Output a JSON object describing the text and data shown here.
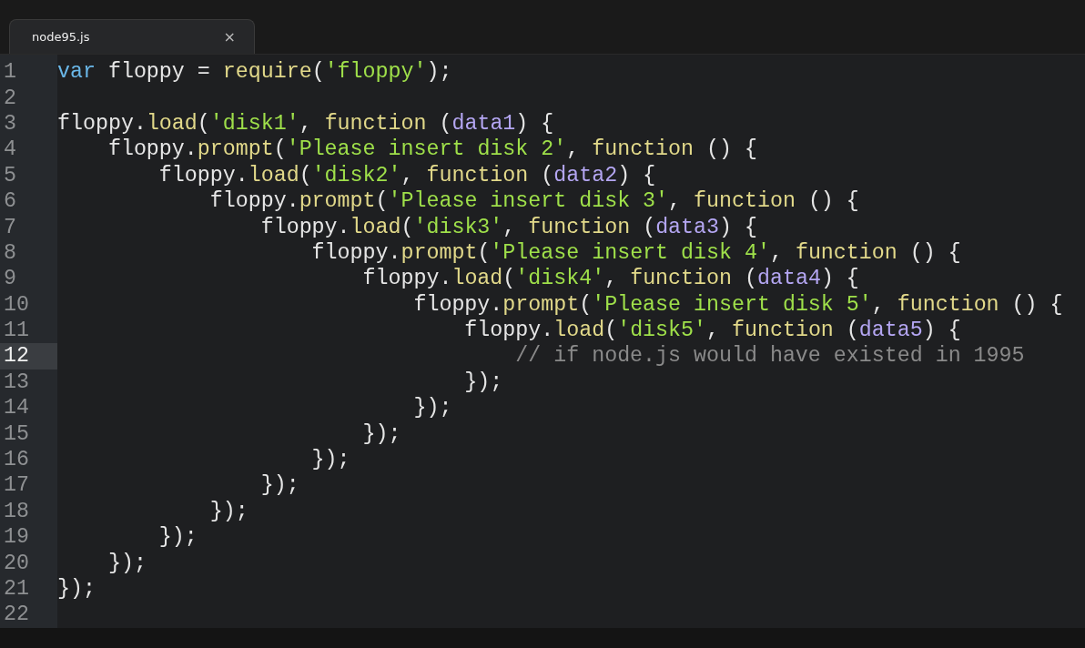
{
  "tabs": [
    {
      "title": "node95.js",
      "close": "×",
      "selected": true
    }
  ],
  "lines": [
    {
      "number": "1",
      "selected": false,
      "tokens": [
        {
          "kind": "keyword",
          "text": "var"
        },
        {
          "kind": "plain",
          "text": " floppy = "
        },
        {
          "kind": "call",
          "text": "require"
        },
        {
          "kind": "plain",
          "text": "("
        },
        {
          "kind": "string",
          "text": "'floppy'"
        },
        {
          "kind": "plain",
          "text": ");"
        }
      ]
    },
    {
      "number": "2",
      "selected": false
    },
    {
      "number": "3",
      "selected": false,
      "tokens": [
        {
          "kind": "plain",
          "text": "floppy."
        },
        {
          "kind": "call",
          "text": "load"
        },
        {
          "kind": "plain",
          "text": "("
        },
        {
          "kind": "string",
          "text": "'disk1'"
        },
        {
          "kind": "plain",
          "text": ", "
        },
        {
          "kind": "call",
          "text": "function"
        },
        {
          "kind": "plain",
          "text": " ("
        },
        {
          "kind": "param",
          "text": "data1"
        },
        {
          "kind": "plain",
          "text": ") {"
        }
      ]
    },
    {
      "number": "4",
      "selected": false,
      "tokens": [
        {
          "kind": "plain",
          "text": "    floppy."
        },
        {
          "kind": "call",
          "text": "prompt"
        },
        {
          "kind": "plain",
          "text": "("
        },
        {
          "kind": "string",
          "text": "'Please insert disk 2'"
        },
        {
          "kind": "plain",
          "text": ", "
        },
        {
          "kind": "call",
          "text": "function"
        },
        {
          "kind": "plain",
          "text": " () {"
        }
      ]
    },
    {
      "number": "5",
      "selected": false,
      "tokens": [
        {
          "kind": "plain",
          "text": "        floppy."
        },
        {
          "kind": "call",
          "text": "load"
        },
        {
          "kind": "plain",
          "text": "("
        },
        {
          "kind": "string",
          "text": "'disk2'"
        },
        {
          "kind": "plain",
          "text": ", "
        },
        {
          "kind": "call",
          "text": "function"
        },
        {
          "kind": "plain",
          "text": " ("
        },
        {
          "kind": "param",
          "text": "data2"
        },
        {
          "kind": "plain",
          "text": ") {"
        }
      ]
    },
    {
      "number": "6",
      "selected": false,
      "tokens": [
        {
          "kind": "plain",
          "text": "            floppy."
        },
        {
          "kind": "call",
          "text": "prompt"
        },
        {
          "kind": "plain",
          "text": "("
        },
        {
          "kind": "string",
          "text": "'Please insert disk 3'"
        },
        {
          "kind": "plain",
          "text": ", "
        },
        {
          "kind": "call",
          "text": "function"
        },
        {
          "kind": "plain",
          "text": " () {"
        }
      ]
    },
    {
      "number": "7",
      "selected": false,
      "tokens": [
        {
          "kind": "plain",
          "text": "                floppy."
        },
        {
          "kind": "call",
          "text": "load"
        },
        {
          "kind": "plain",
          "text": "("
        },
        {
          "kind": "string",
          "text": "'disk3'"
        },
        {
          "kind": "plain",
          "text": ", "
        },
        {
          "kind": "call",
          "text": "function"
        },
        {
          "kind": "plain",
          "text": " ("
        },
        {
          "kind": "param",
          "text": "data3"
        },
        {
          "kind": "plain",
          "text": ") {"
        }
      ]
    },
    {
      "number": "8",
      "selected": false,
      "tokens": [
        {
          "kind": "plain",
          "text": "                    floppy."
        },
        {
          "kind": "call",
          "text": "prompt"
        },
        {
          "kind": "plain",
          "text": "("
        },
        {
          "kind": "string",
          "text": "'Please insert disk 4'"
        },
        {
          "kind": "plain",
          "text": ", "
        },
        {
          "kind": "call",
          "text": "function"
        },
        {
          "kind": "plain",
          "text": " () {"
        }
      ]
    },
    {
      "number": "9",
      "selected": false,
      "tokens": [
        {
          "kind": "plain",
          "text": "                        floppy."
        },
        {
          "kind": "call",
          "text": "load"
        },
        {
          "kind": "plain",
          "text": "("
        },
        {
          "kind": "string",
          "text": "'disk4'"
        },
        {
          "kind": "plain",
          "text": ", "
        },
        {
          "kind": "call",
          "text": "function"
        },
        {
          "kind": "plain",
          "text": " ("
        },
        {
          "kind": "param",
          "text": "data4"
        },
        {
          "kind": "plain",
          "text": ") {"
        }
      ]
    },
    {
      "number": "10",
      "selected": false,
      "tokens": [
        {
          "kind": "plain",
          "text": "                            floppy."
        },
        {
          "kind": "call",
          "text": "prompt"
        },
        {
          "kind": "plain",
          "text": "("
        },
        {
          "kind": "string",
          "text": "'Please insert disk 5'"
        },
        {
          "kind": "plain",
          "text": ", "
        },
        {
          "kind": "call",
          "text": "function"
        },
        {
          "kind": "plain",
          "text": " () {"
        }
      ]
    },
    {
      "number": "11",
      "selected": false,
      "tokens": [
        {
          "kind": "plain",
          "text": "                                floppy."
        },
        {
          "kind": "call",
          "text": "load"
        },
        {
          "kind": "plain",
          "text": "("
        },
        {
          "kind": "string",
          "text": "'disk5'"
        },
        {
          "kind": "plain",
          "text": ", "
        },
        {
          "kind": "call",
          "text": "function"
        },
        {
          "kind": "plain",
          "text": " ("
        },
        {
          "kind": "param",
          "text": "data5"
        },
        {
          "kind": "plain",
          "text": ") {"
        }
      ]
    },
    {
      "number": "12",
      "selected": true,
      "tokens": [
        {
          "kind": "comment",
          "text": "                                    // if node.js would have existed in 1995"
        }
      ]
    },
    {
      "number": "13",
      "selected": false,
      "tokens": [
        {
          "kind": "plain",
          "text": "                                });"
        }
      ]
    },
    {
      "number": "14",
      "selected": false,
      "tokens": [
        {
          "kind": "plain",
          "text": "                            });"
        }
      ]
    },
    {
      "number": "15",
      "selected": false,
      "tokens": [
        {
          "kind": "plain",
          "text": "                        });"
        }
      ]
    },
    {
      "number": "16",
      "selected": false,
      "tokens": [
        {
          "kind": "plain",
          "text": "                    });"
        }
      ]
    },
    {
      "number": "17",
      "selected": false,
      "tokens": [
        {
          "kind": "plain",
          "text": "                });"
        }
      ]
    },
    {
      "number": "18",
      "selected": false,
      "tokens": [
        {
          "kind": "plain",
          "text": "            });"
        }
      ]
    },
    {
      "number": "19",
      "selected": false,
      "tokens": [
        {
          "kind": "plain",
          "text": "        });"
        }
      ]
    },
    {
      "number": "20",
      "selected": false,
      "tokens": [
        {
          "kind": "plain",
          "text": "    });"
        }
      ]
    },
    {
      "number": "21",
      "selected": false,
      "tokens": [
        {
          "kind": "plain",
          "text": "});"
        }
      ]
    },
    {
      "number": "22",
      "selected": false
    }
  ]
}
